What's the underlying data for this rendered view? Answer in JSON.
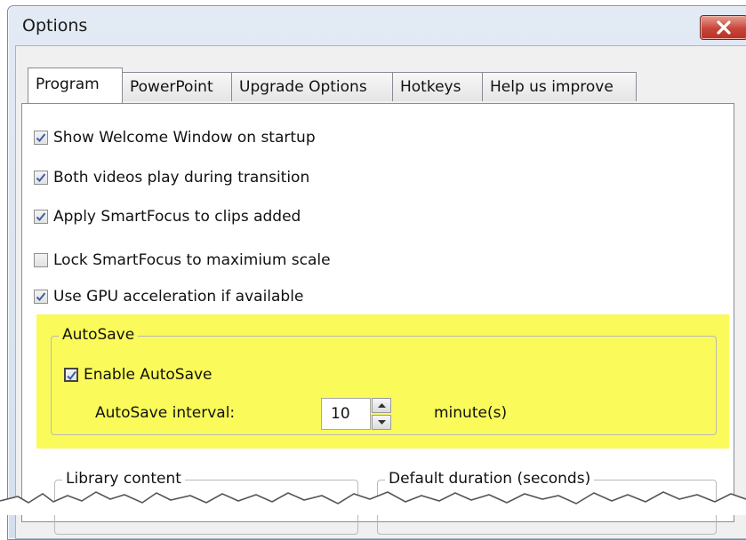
{
  "window": {
    "title": "Options",
    "close_icon": "close-icon",
    "close_color": "#c7453a"
  },
  "tabs": [
    {
      "label": "Program",
      "active": true
    },
    {
      "label": "PowerPoint",
      "active": false
    },
    {
      "label": "Upgrade Options",
      "active": false
    },
    {
      "label": "Hotkeys",
      "active": false
    },
    {
      "label": "Help us improve",
      "active": false
    }
  ],
  "program": {
    "options": [
      {
        "label": "Show Welcome Window on startup",
        "checked": true
      },
      {
        "label": "Both videos play during transition",
        "checked": true
      },
      {
        "label": "Apply SmartFocus to clips added",
        "checked": true
      },
      {
        "label": "Lock SmartFocus to maximium scale",
        "checked": false
      },
      {
        "label": "Use GPU acceleration if available",
        "checked": true
      }
    ],
    "autosave": {
      "group_label": "AutoSave",
      "enable_label": "Enable AutoSave",
      "enable_checked": true,
      "interval_label": "AutoSave interval:",
      "interval_value": "10",
      "unit_label": "minute(s)",
      "highlight_color": "#fafa5a"
    },
    "library_group_label": "Library content",
    "duration_group_label": "Default duration (seconds)"
  }
}
